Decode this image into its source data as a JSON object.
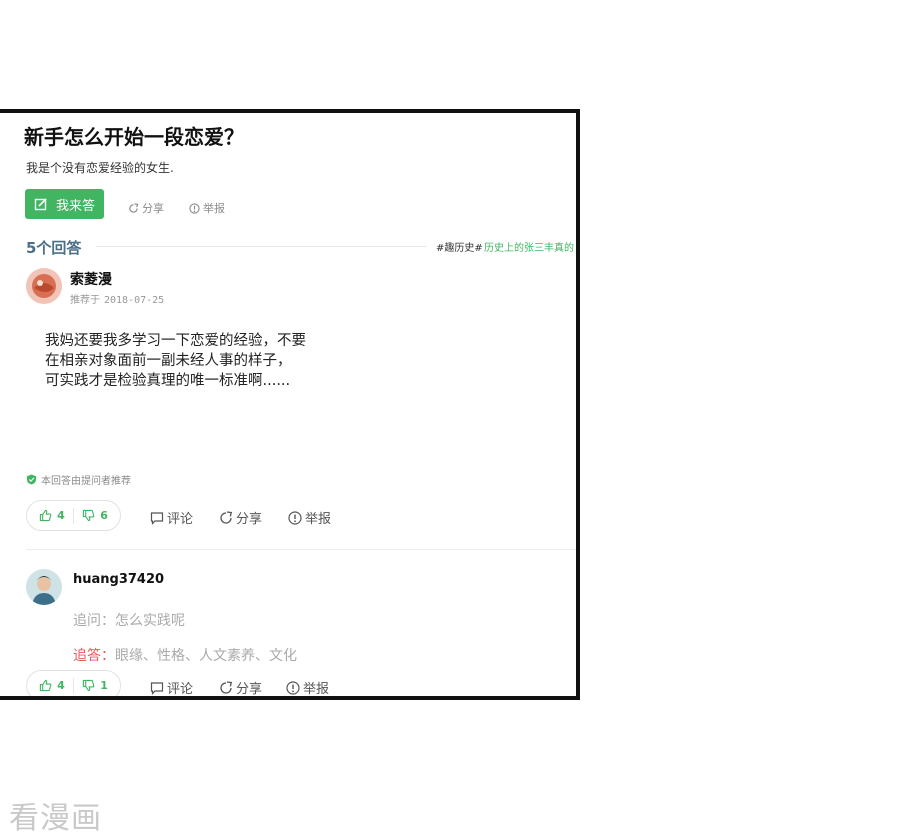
{
  "question": {
    "title": "新手怎么开始一段恋爱？",
    "description": "我是个没有恋爱经验的女生."
  },
  "actions": {
    "answer_button": "我来答",
    "share": "分享",
    "report": "举报"
  },
  "answers_header": {
    "count_label": "5个回答",
    "topic_tag": "#趣历史#",
    "topic_link": "历史上的张三丰真的"
  },
  "answers": [
    {
      "user": "索菱漫",
      "recommend_label": "推荐于",
      "date": "2018-07-25",
      "lines": [
        "我妈还要我多学习一下恋爱的经验，不要",
        "在相亲对象面前一副未经人事的样子，",
        "可实践才是检验真理的唯一标准啊......"
      ],
      "endorsement": "本回答由提问者推荐",
      "upvotes": "4",
      "downvotes": "6",
      "comment": "评论",
      "share": "分享",
      "report": "举报"
    },
    {
      "user": "huang37420",
      "followup_q_label": "追问：",
      "followup_q": "怎么实践呢",
      "followup_a_label": "追答：",
      "followup_a": "眼缘、性格、人文素养、文化",
      "upvotes": "4",
      "downvotes": "1",
      "comment": "评论",
      "share": "分享",
      "report": "举报"
    }
  ],
  "colors": {
    "accent": "#41b561",
    "count": "#4a6f86",
    "followup_red": "#e85a5a"
  },
  "icons": [
    "edit-icon",
    "share-icon",
    "report-icon",
    "shield-check-icon",
    "thumbs-up-icon",
    "thumbs-down-icon",
    "comment-icon"
  ],
  "watermark": "看漫画"
}
